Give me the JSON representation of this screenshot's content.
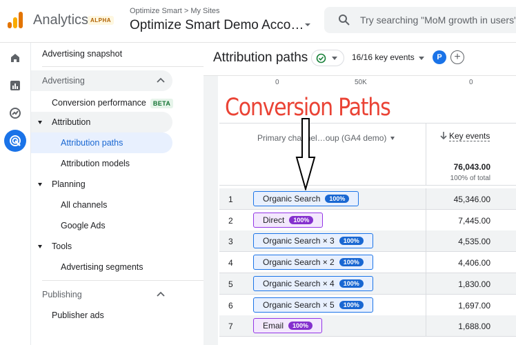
{
  "app": {
    "brand": "Analytics",
    "alpha_badge": "ALPHA",
    "breadcrumb": "Optimize Smart > My Sites",
    "account": "Optimize Smart Demo Acco…",
    "search_placeholder": "Try searching \"MoM growth in users\""
  },
  "rail": {
    "items": [
      {
        "icon": "home-icon"
      },
      {
        "icon": "reports-icon"
      },
      {
        "icon": "explore-icon"
      },
      {
        "icon": "advertising-icon",
        "active": true
      }
    ]
  },
  "nav": {
    "snapshot": "Advertising snapshot",
    "advertising_section": "Advertising",
    "conversion_performance": "Conversion performance",
    "beta": "BETA",
    "attribution": "Attribution",
    "attribution_paths": "Attribution paths",
    "attribution_models": "Attribution models",
    "planning": "Planning",
    "all_channels": "All channels",
    "google_ads": "Google Ads",
    "tools": "Tools",
    "advertising_segments": "Advertising segments",
    "publishing_section": "Publishing",
    "publisher_ads": "Publisher ads"
  },
  "main": {
    "title": "Attribution paths",
    "key_events_selector": "16/16 key events",
    "avatar_letter": "P",
    "axis_labels": [
      "0",
      "50K",
      "0"
    ],
    "overlay_title": "Conversion Paths",
    "dimension_header": "Primary channel…oup (GA4 demo)",
    "metric_header": "Key events",
    "total": "76,043.00",
    "total_sub": "100% of total"
  },
  "rows": [
    {
      "num": "1",
      "path": "Organic Search",
      "pct": "100%",
      "value": "45,346.00",
      "color": "blue"
    },
    {
      "num": "2",
      "path": "Direct",
      "pct": "100%",
      "value": "7,445.00",
      "color": "purple"
    },
    {
      "num": "3",
      "path": "Organic Search × 3",
      "pct": "100%",
      "value": "4,535.00",
      "color": "blue"
    },
    {
      "num": "4",
      "path": "Organic Search × 2",
      "pct": "100%",
      "value": "4,406.00",
      "color": "blue"
    },
    {
      "num": "5",
      "path": "Organic Search × 4",
      "pct": "100%",
      "value": "1,830.00",
      "color": "blue"
    },
    {
      "num": "6",
      "path": "Organic Search × 5",
      "pct": "100%",
      "value": "1,697.00",
      "color": "blue"
    },
    {
      "num": "7",
      "path": "Email",
      "pct": "100%",
      "value": "1,688.00",
      "color": "purple"
    }
  ],
  "colors": {
    "accent": "#1a73e8",
    "overlay_red": "#ea4335",
    "chip_blue": "#1967d2",
    "chip_purple": "#8430ce"
  }
}
